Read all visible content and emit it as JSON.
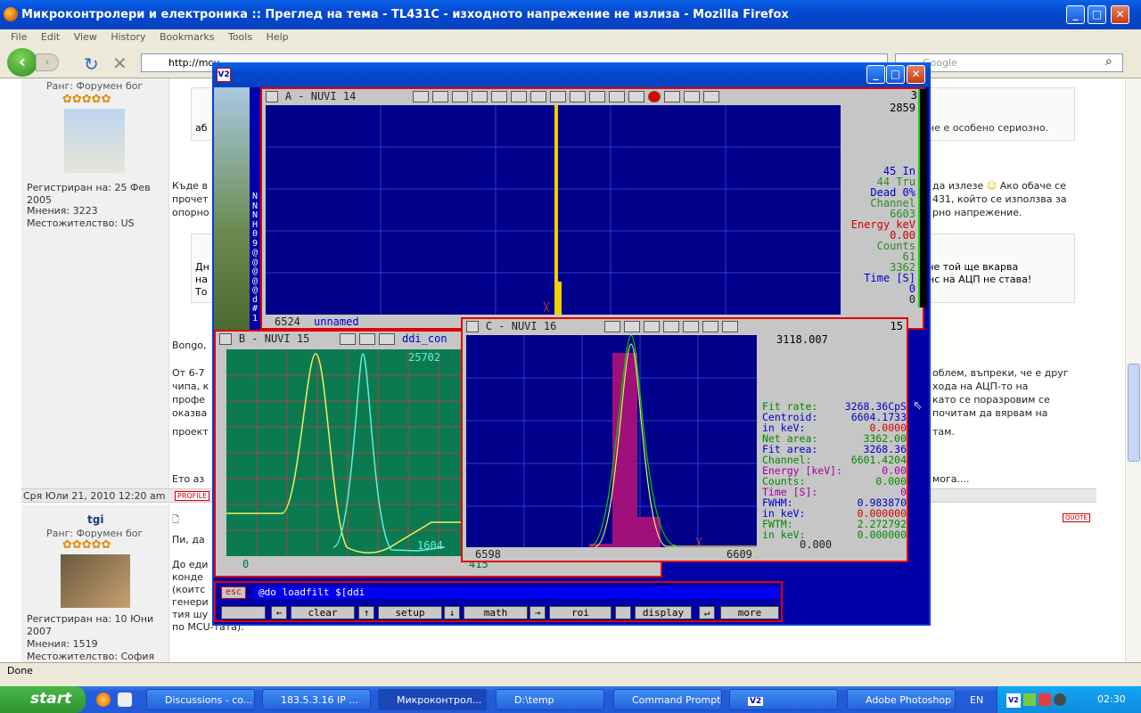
{
  "firefox": {
    "title": "Микроконтролери и електроника :: Преглед на тема - TL431C - изходното напрежение не излиза - Mozilla Firefox",
    "menu": [
      "File",
      "Edit",
      "View",
      "History",
      "Bookmarks",
      "Tools",
      "Help"
    ],
    "url": "http://mcu",
    "search_placeholder": "Google",
    "status": "Done"
  },
  "forum": {
    "post1": {
      "rank": "Ранг: Форумен бог",
      "registered": "Регистриран на: 25 Фев 2005",
      "posts": "Мнения: 3223",
      "location": "Местожителство: US",
      "date": "Сря Юли 21, 2010 12:20 am",
      "profile": "PROFILE",
      "quote1": "аб",
      "quote1_right": "не е особено сериозно.",
      "text1a": "Къде в",
      "text1b": "прочет",
      "text1c": "опорно",
      "text1_r1": "да излезе",
      "text1_r2": "Ако обаче се",
      "text1_r3": "431, който се използва за",
      "text1_r4": "рно напрежение.",
      "quote2a": "Дн",
      "quote2b": "на",
      "quote2c": "То",
      "quote2_r1": "че той ще вкарва",
      "quote2_r2": "нс на АЦП не става!",
      "p_bongo": "Bongo,",
      "p2a": "От 6-7",
      "p2b": "чипа, к",
      "p2c": "профе",
      "p2d": "оказва",
      "p2e": "проект",
      "p2_r1": "облем, въпреки, че е друг",
      "p2_r2": "хода на АЦП-то на",
      "p2_r3": "като се поразровим се",
      "p2_r4": "почитам да вярвам на",
      "p2_r5": "там.",
      "eto": "Ето аз",
      "eto_r": "мога...."
    },
    "post2": {
      "name": "tgi",
      "rank": "Ранг: Форумен бог",
      "registered": "Регистриран на: 10 Юни 2007",
      "posts": "Мнения: 1519",
      "location": "Местожителство: София",
      "quote": "QUOTE",
      "l1": "Пи, да",
      "l2": "До еди",
      "l3": "конде",
      "l4": "(коитс",
      "l5": "генери",
      "l6": "тия шу",
      "l7": "по MCU-тата)."
    }
  },
  "v2": {
    "panelA": {
      "title": "A - NUVI 14",
      "top_right": "3",
      "max": "2859",
      "left_ch": "6524",
      "name": "unnamed",
      "stats": [
        {
          "t": "45  In",
          "c": "#0000c8"
        },
        {
          "t": "44 Tru",
          "c": "#2a8a2a"
        },
        {
          "t": "Dead  0%",
          "c": "#0000c8"
        },
        {
          "t": "Channel",
          "c": "#2a8a2a"
        },
        {
          "t": "6603",
          "c": "#2a8a2a"
        },
        {
          "t": "Energy keV",
          "c": "#d00000"
        },
        {
          "t": "0.00",
          "c": "#d00000"
        },
        {
          "t": "Counts",
          "c": "#2a8a2a"
        },
        {
          "t": "61",
          "c": "#2a8a2a"
        },
        {
          "t": "3362",
          "c": "#2a8a2a"
        },
        {
          "t": "Time  [S]",
          "c": "#0000c8"
        },
        {
          "t": "0",
          "c": "#0000c8"
        },
        {
          "t": "0",
          "c": "#222"
        }
      ]
    },
    "side_letters": [
      "N",
      "N",
      "N",
      "H",
      "0",
      "9",
      "@",
      "@",
      "@",
      "@",
      "@",
      "d",
      "#",
      "1"
    ],
    "panelB": {
      "title": "B - NUVI 15",
      "tab": "ddi_con",
      "peak": "25702",
      "low": "1604",
      "left_ch": "0",
      "right_ch": "415"
    },
    "panelC": {
      "title": "C - NUVI 16",
      "top_right": "15",
      "max": "3118.007",
      "left_ch": "6598",
      "right_ch": "6609",
      "fit": [
        {
          "k": "Fit rate:",
          "v": "3268.36CpS",
          "kc": "#008800",
          "vc": "#0000c8"
        },
        {
          "k": "Centroid:",
          "v": "6604.1733",
          "kc": "#0000c8",
          "vc": "#0000c8"
        },
        {
          "k": "in keV:",
          "v": "0.0000",
          "kc": "#0000c8",
          "vc": "#d00000"
        },
        {
          "k": "Net area:",
          "v": "3362.00",
          "kc": "#008800",
          "vc": "#008800"
        },
        {
          "k": "Fit area:",
          "v": "3268.36",
          "kc": "#0000c8",
          "vc": "#0000c8"
        },
        {
          "k": "Channel:",
          "v": "6601.4204",
          "kc": "#008800",
          "vc": "#008800"
        },
        {
          "k": "Energy [keV]:",
          "v": "0.00",
          "kc": "#a000a0",
          "vc": "#a000a0"
        },
        {
          "k": "Counts:",
          "v": "0.000",
          "kc": "#008800",
          "vc": "#008800"
        },
        {
          "k": "Time [S]:",
          "v": "0",
          "kc": "#a000a0",
          "vc": "#a000a0"
        },
        {
          "k": "FWHM:",
          "v": "0.983870",
          "kc": "#0000c8",
          "vc": "#0000c8"
        },
        {
          "k": "in keV:",
          "v": "0.000000",
          "kc": "#0000c8",
          "vc": "#d00000"
        },
        {
          "k": "FWTM:",
          "v": "2.272792",
          "kc": "#008800",
          "vc": "#008800"
        },
        {
          "k": "in keV:",
          "v": "0.000000",
          "kc": "#008800",
          "vc": "#008800"
        }
      ],
      "bottom": "0.000"
    },
    "command": {
      "esc": "esc",
      "input": "@do loadfilt $[ddi",
      "buttons": [
        "clear",
        "setup",
        "math",
        "roi",
        "display",
        "more"
      ],
      "arrows": [
        "←",
        "↑",
        "↓",
        "→",
        "↵"
      ]
    }
  },
  "taskbar": {
    "start": "start",
    "items": [
      "Discussions - co...",
      "183.5.3.16 IP ...",
      "Микроконтрол...",
      "D:\\temp",
      "Command Prompt",
      "",
      "Adobe Photoshop"
    ],
    "lang": "EN",
    "clock": "02:30"
  }
}
